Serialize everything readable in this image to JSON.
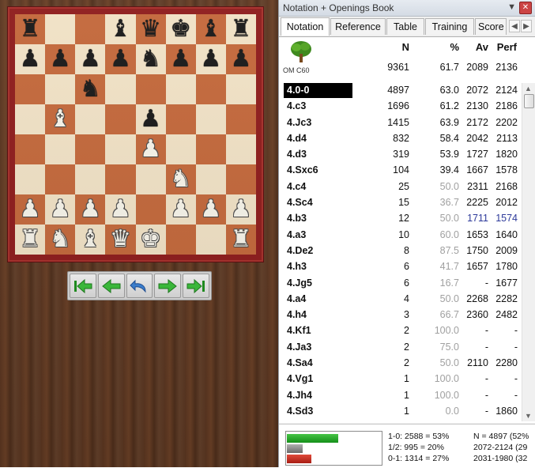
{
  "board": {
    "squares": [
      [
        "bR",
        "",
        "",
        "bB",
        "bQ",
        "bK",
        "bB",
        ""
      ],
      [
        "",
        "",
        "",
        "",
        "",
        "",
        "",
        ""
      ],
      [
        "",
        "",
        "",
        "",
        "",
        "",
        "",
        ""
      ],
      [
        "",
        "",
        "",
        "",
        "",
        "",
        "",
        ""
      ],
      [
        "",
        "",
        "",
        "",
        "",
        "",
        "",
        ""
      ],
      [
        "",
        "",
        "",
        "",
        "",
        "",
        "",
        ""
      ],
      [
        "",
        "",
        "",
        "",
        "",
        "",
        "",
        ""
      ],
      [
        "",
        "",
        "",
        "",
        "",
        "",
        "",
        ""
      ]
    ],
    "pieces": [
      {
        "sq": "a8",
        "p": "bR"
      },
      {
        "sq": "d8",
        "p": "bB"
      },
      {
        "sq": "e8",
        "p": "bQ"
      },
      {
        "sq": "f8",
        "p": "bK"
      },
      {
        "sq": "g8",
        "p": "bB"
      },
      {
        "sq": "h8",
        "p": "bR"
      },
      {
        "sq": "a7",
        "p": "bP"
      },
      {
        "sq": "b7",
        "p": "bP"
      },
      {
        "sq": "c7",
        "p": "bP"
      },
      {
        "sq": "d7",
        "p": "bP"
      },
      {
        "sq": "e7",
        "p": "bN"
      },
      {
        "sq": "f7",
        "p": "bP"
      },
      {
        "sq": "g7",
        "p": "bP"
      },
      {
        "sq": "h7",
        "p": "bP"
      },
      {
        "sq": "c6",
        "p": "bN"
      },
      {
        "sq": "b5",
        "p": "wB"
      },
      {
        "sq": "e5",
        "p": "bP"
      },
      {
        "sq": "e4",
        "p": "wP"
      },
      {
        "sq": "f3",
        "p": "wN"
      },
      {
        "sq": "a2",
        "p": "wP"
      },
      {
        "sq": "b2",
        "p": "wP"
      },
      {
        "sq": "c2",
        "p": "wP"
      },
      {
        "sq": "d2",
        "p": "wP"
      },
      {
        "sq": "f2",
        "p": "wP"
      },
      {
        "sq": "g2",
        "p": "wP"
      },
      {
        "sq": "h2",
        "p": "wP"
      },
      {
        "sq": "a1",
        "p": "wR"
      },
      {
        "sq": "b1",
        "p": "wN"
      },
      {
        "sq": "c1",
        "p": "wB"
      },
      {
        "sq": "d1",
        "p": "wQ"
      },
      {
        "sq": "e1",
        "p": "wK"
      },
      {
        "sq": "h1",
        "p": "wR"
      }
    ]
  },
  "nav": {
    "buttons": [
      "first-move",
      "previous-move",
      "take-back",
      "next-move",
      "last-move"
    ]
  },
  "panel": {
    "title": "Notation + Openings Book",
    "pin": "▼",
    "close": "✕",
    "tabs": [
      "Notation",
      "Reference",
      "Table",
      "Training",
      "Score"
    ],
    "active_tab": "Notation",
    "headers": {
      "n": "N",
      "pct": "%",
      "av": "Av",
      "perf": "Perf"
    },
    "opening": "OM C60",
    "totals": {
      "n": "9361",
      "pct": "61.7",
      "av": "2089",
      "perf": "2136"
    },
    "rows": [
      {
        "move": "4.0-0",
        "n": "4897",
        "pct": "63.0",
        "av": "2072",
        "perf": "2124",
        "selected": true
      },
      {
        "move": "4.c3",
        "n": "1696",
        "pct": "61.2",
        "av": "2130",
        "perf": "2186"
      },
      {
        "move": "4.Jc3",
        "n": "1415",
        "pct": "63.9",
        "av": "2172",
        "perf": "2202"
      },
      {
        "move": "4.d4",
        "n": "832",
        "pct": "58.4",
        "av": "2042",
        "perf": "2113"
      },
      {
        "move": "4.d3",
        "n": "319",
        "pct": "53.9",
        "av": "1727",
        "perf": "1820"
      },
      {
        "move": "4.Sxc6",
        "n": "104",
        "pct": "39.4",
        "av": "1667",
        "perf": "1578"
      },
      {
        "move": "4.c4",
        "n": "25",
        "pct": "50.0",
        "av": "2311",
        "perf": "2168",
        "pct_grey": true
      },
      {
        "move": "4.Sc4",
        "n": "15",
        "pct": "36.7",
        "av": "2225",
        "perf": "2012",
        "pct_grey": true
      },
      {
        "move": "4.b3",
        "n": "12",
        "pct": "50.0",
        "av": "1711",
        "perf": "1574",
        "pct_grey": true,
        "blue": true
      },
      {
        "move": "4.a3",
        "n": "10",
        "pct": "60.0",
        "av": "1653",
        "perf": "1640",
        "pct_grey": true
      },
      {
        "move": "4.De2",
        "n": "8",
        "pct": "87.5",
        "av": "1750",
        "perf": "2009",
        "pct_grey": true
      },
      {
        "move": "4.h3",
        "n": "6",
        "pct": "41.7",
        "av": "1657",
        "perf": "1780",
        "pct_grey": true
      },
      {
        "move": "4.Jg5",
        "n": "6",
        "pct": "16.7",
        "av": "-",
        "perf": "1677",
        "pct_grey": true
      },
      {
        "move": "4.a4",
        "n": "4",
        "pct": "50.0",
        "av": "2268",
        "perf": "2282",
        "pct_grey": true
      },
      {
        "move": "4.h4",
        "n": "3",
        "pct": "66.7",
        "av": "2360",
        "perf": "2482",
        "pct_grey": true
      },
      {
        "move": "4.Kf1",
        "n": "2",
        "pct": "100.0",
        "av": "-",
        "perf": "-",
        "pct_grey": true
      },
      {
        "move": "4.Ja3",
        "n": "2",
        "pct": "75.0",
        "av": "-",
        "perf": "-",
        "pct_grey": true
      },
      {
        "move": "4.Sa4",
        "n": "2",
        "pct": "50.0",
        "av": "2110",
        "perf": "2280",
        "pct_grey": true
      },
      {
        "move": "4.Vg1",
        "n": "1",
        "pct": "100.0",
        "av": "-",
        "perf": "-",
        "pct_grey": true
      },
      {
        "move": "4.Jh4",
        "n": "1",
        "pct": "100.0",
        "av": "-",
        "perf": "-",
        "pct_grey": true
      },
      {
        "move": "4.Sd3",
        "n": "1",
        "pct": "0.0",
        "av": "-",
        "perf": "1860",
        "pct_grey": true
      }
    ],
    "stats": {
      "win_text": "1-0: 2588 = 53%",
      "draw_text": "1/2: 995 = 20%",
      "loss_text": "0-1: 1314 = 27%",
      "r1": "N = 4897 (52%",
      "r2": "2072-2124 (29",
      "r3": "2031-1980 (32",
      "win_frac": 0.53,
      "draw_frac": 0.2,
      "loss_frac": 0.27
    }
  },
  "colors": {
    "board_frame": "#8f1d1d",
    "light_square": "#f1e2c6",
    "dark_square": "#c4693c",
    "selection": "#000000",
    "win_bar": "#1e9c24",
    "draw_bar": "#808080",
    "loss_bar": "#b8241a"
  }
}
